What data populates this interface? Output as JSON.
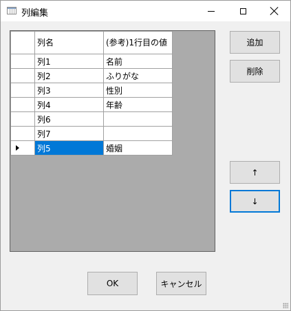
{
  "window": {
    "title": "列編集"
  },
  "grid": {
    "headers": [
      "列名",
      "(参考)1行目の値"
    ],
    "rows": [
      {
        "name": "列1",
        "value": "名前",
        "selected": false
      },
      {
        "name": "列2",
        "value": "ふりがな",
        "selected": false
      },
      {
        "name": "列3",
        "value": "性別",
        "selected": false
      },
      {
        "name": "列4",
        "value": "年齢",
        "selected": false
      },
      {
        "name": "列6",
        "value": "",
        "selected": false
      },
      {
        "name": "列7",
        "value": "",
        "selected": false
      },
      {
        "name": "列5",
        "value": "婚姻",
        "selected": true
      }
    ]
  },
  "buttons": {
    "add": "追加",
    "delete": "削除",
    "up": "↑",
    "down": "↓",
    "ok": "OK",
    "cancel": "キャンセル"
  },
  "icons": {
    "app": "table-window-icon",
    "current_row": "row-pointer-arrow-icon"
  },
  "colors": {
    "selection": "#0078d7",
    "focus_border": "#0078d7",
    "grid_background": "#ababab"
  }
}
